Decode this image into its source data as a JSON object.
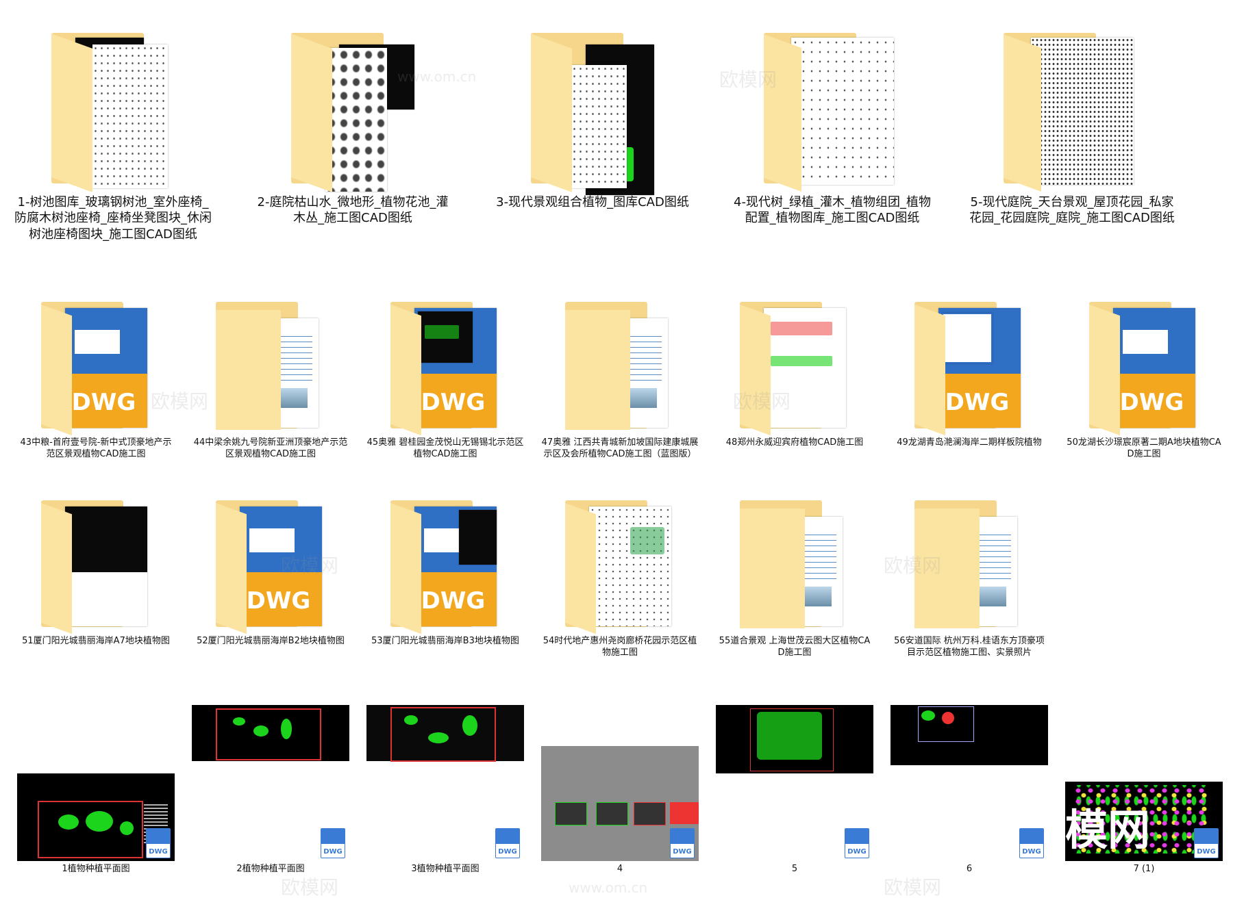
{
  "row1": [
    {
      "label": "1-树池图库_玻璃钢树池_室外座椅_防腐木树池座椅_座椅坐凳图块_休闲树池座椅图块_施工图CAD图纸"
    },
    {
      "label": "2-庭院枯山水_微地形_植物花池_灌木丛_施工图CAD图纸"
    },
    {
      "label": "3-现代景观组合植物_图库CAD图纸"
    },
    {
      "label": "4-现代树_绿植_灌木_植物组团_植物配置_植物图库_施工图CAD图纸"
    },
    {
      "label": "5-现代庭院_天台景观_屋顶花园_私家花园_花园庭院_庭院_施工图CAD图纸"
    }
  ],
  "row2": [
    {
      "label": "43中粮-首府壹号院-新中式顶豪地产示范区景观植物CAD施工图"
    },
    {
      "label": "44中梁余姚九号院新亚洲顶豪地产示范区景观植物CAD施工图"
    },
    {
      "label": "45奥雅 碧桂园金茂悦山无锡锡北示范区植物CAD施工图"
    },
    {
      "label": "47奥雅 江西共青城新加坡国际建康城展示区及会所植物CAD施工图（蓝图版）"
    },
    {
      "label": "48郑州永威迎宾府植物CAD施工图"
    },
    {
      "label": "49龙湖青岛滟澜海岸二期样板院植物"
    },
    {
      "label": "50龙湖长沙璟宸原著二期A地块植物CAD施工图"
    }
  ],
  "row3": [
    {
      "label": "51厦门阳光城翡丽海岸A7地块植物图"
    },
    {
      "label": "52厦门阳光城翡丽海岸B2地块植物图"
    },
    {
      "label": "53厦门阳光城翡丽海岸B3地块植物图"
    },
    {
      "label": "54时代地产惠州尧岗廊桥花园示范区植物施工图"
    },
    {
      "label": "55道合景观 上海世茂云图大区植物CAD施工图"
    },
    {
      "label": "56安道国际 杭州万科.桂语东方顶豪项目示范区植物施工图、实景照片"
    }
  ],
  "row4": [
    {
      "label": "1植物种植平面图"
    },
    {
      "label": "2植物种植平面图"
    },
    {
      "label": "3植物种植平面图"
    },
    {
      "label": "4"
    },
    {
      "label": "5"
    },
    {
      "label": "6"
    },
    {
      "label": "7 (1)"
    }
  ],
  "file_badge": "DWG",
  "overlay_text": "模网",
  "watermarks": [
    "欧模网",
    "www.om.cn"
  ]
}
